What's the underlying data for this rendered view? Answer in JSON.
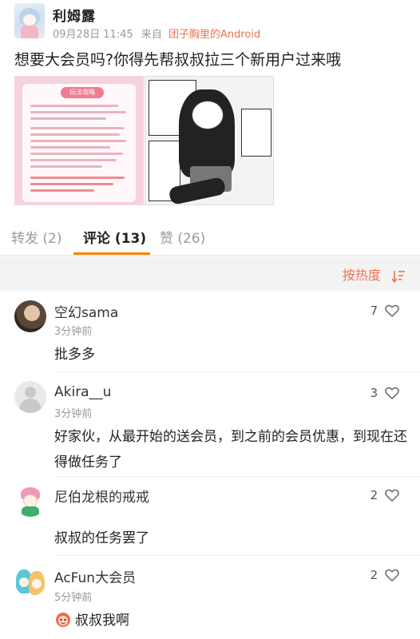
{
  "post": {
    "username": "利姆露",
    "time": "09月28日 11:45",
    "source_prefix": "来自",
    "source": "团子胸里的Android",
    "text": "想要大会员吗?你得先帮叔叔拉三个新用户过来哦",
    "image1_title": "玩法攻略"
  },
  "tabs": {
    "repost": "转发 (2)",
    "comments": "评论 (13)",
    "likes": "赞 (26)"
  },
  "sort": {
    "label": "按热度"
  },
  "comments": [
    {
      "name": "空幻sama",
      "time": "3分钟前",
      "text": "批多多",
      "likes": "7"
    },
    {
      "name": "Akira__u",
      "time": "3分钟前",
      "text": "好家伙，从最开始的送会员，到之前的会员优惠，到现在还得做任务了",
      "likes": "3"
    },
    {
      "name": "尼伯龙根的戒戒",
      "time": "",
      "text": "叔叔的任务罢了",
      "likes": "2"
    },
    {
      "name": "AcFun大会员",
      "time": "5分钟前",
      "text": "叔叔我啊",
      "likes": "2"
    }
  ],
  "colors": {
    "accent": "#eb7350",
    "tab_underline": "#ff8200",
    "muted": "#9a9a9a"
  }
}
